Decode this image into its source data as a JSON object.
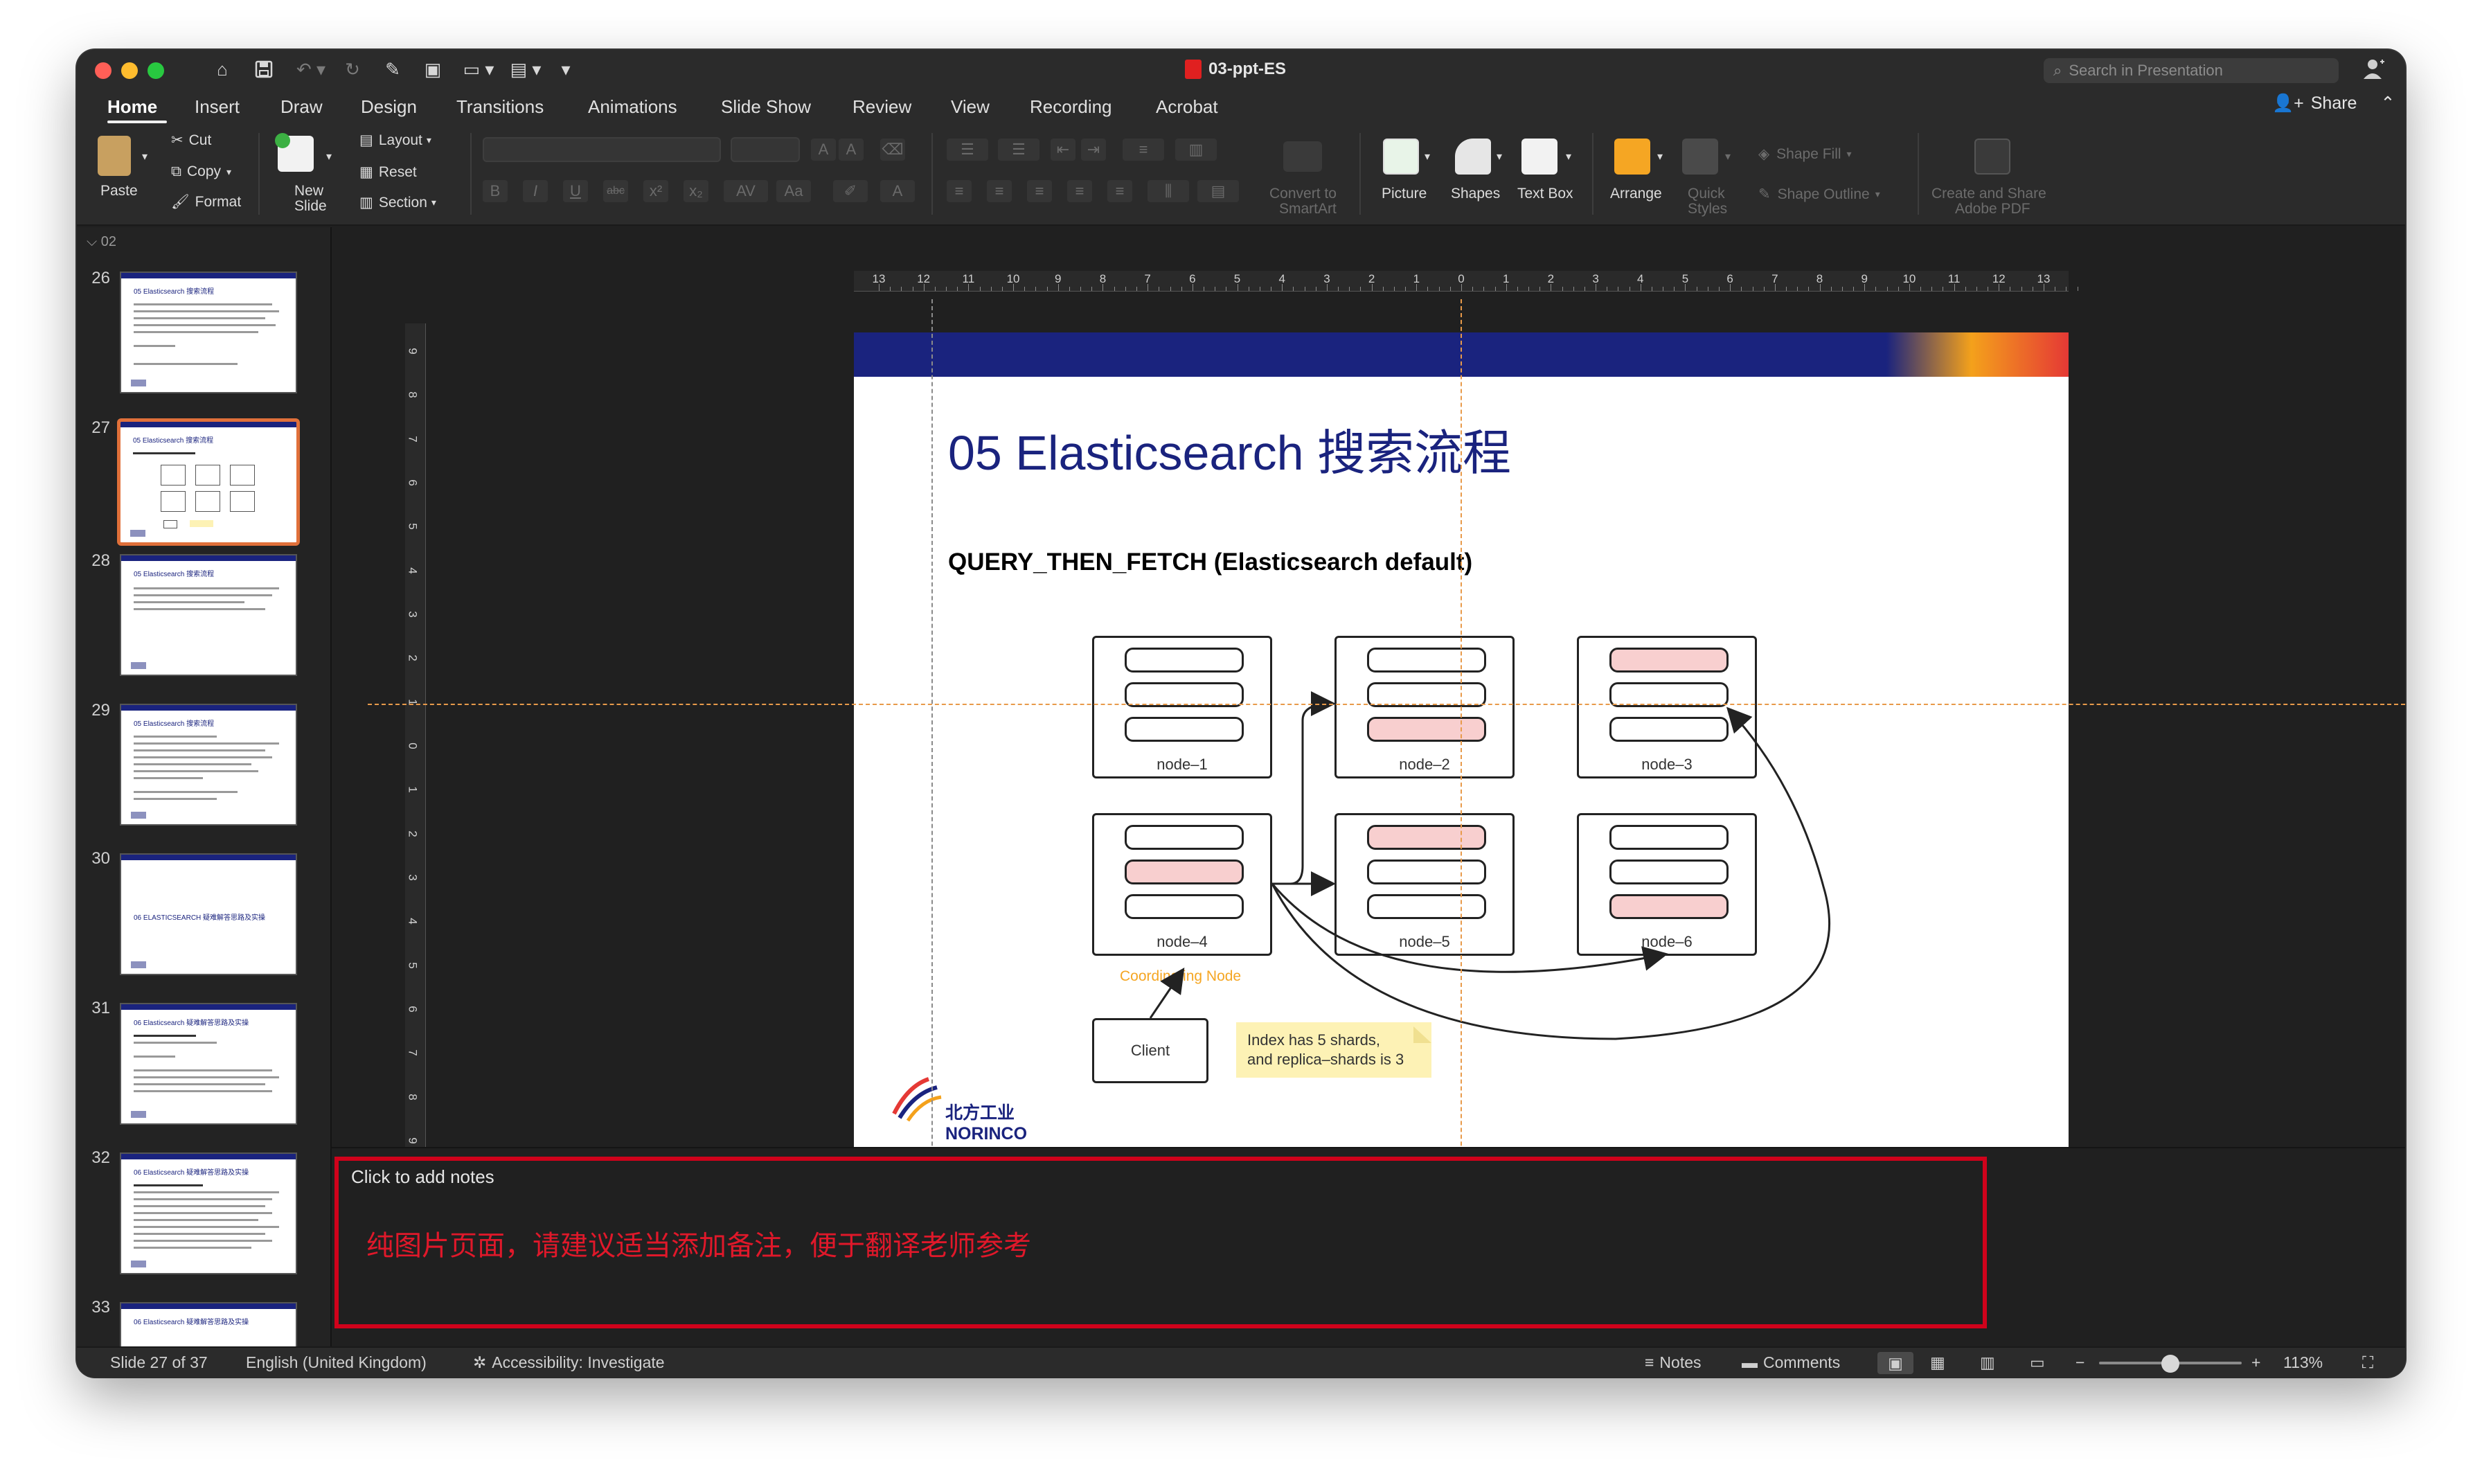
{
  "window": {
    "title": "03-ppt-ES",
    "search_placeholder": "Search in Presentation",
    "share_label": "Share"
  },
  "tabs": [
    "Home",
    "Insert",
    "Draw",
    "Design",
    "Transitions",
    "Animations",
    "Slide Show",
    "Review",
    "View",
    "Recording",
    "Acrobat"
  ],
  "ribbon": {
    "paste": "Paste",
    "cut": "Cut",
    "copy": "Copy",
    "format": "Format",
    "new_slide_1": "New",
    "new_slide_2": "Slide",
    "layout": "Layout",
    "reset": "Reset",
    "section": "Section",
    "convert_1": "Convert to",
    "convert_2": "SmartArt",
    "picture": "Picture",
    "shapes": "Shapes",
    "text_box": "Text Box",
    "arrange": "Arrange",
    "quick_1": "Quick",
    "quick_2": "Styles",
    "shape_fill": "Shape Fill",
    "shape_outline": "Shape Outline",
    "create_share_1": "Create and Share",
    "create_share_2": "Adobe PDF"
  },
  "slides_panel": {
    "section": "02",
    "thumbnails": [
      {
        "num": "26",
        "title": "05 Elasticsearch 搜索流程"
      },
      {
        "num": "27",
        "title": "05 Elasticsearch 搜索流程"
      },
      {
        "num": "28",
        "title": "05 Elasticsearch 搜索流程"
      },
      {
        "num": "29",
        "title": "05 Elasticsearch 搜索流程"
      },
      {
        "num": "30",
        "title": "06 ELASTICSEARCH 疑难解答思路及实操"
      },
      {
        "num": "31",
        "title": "06 Elasticsearch 疑难解答思路及实操"
      },
      {
        "num": "32",
        "title": "06 Elasticsearch 疑难解答思路及实操"
      },
      {
        "num": "33",
        "title": "06 Elasticsearch 疑难解答思路及实操"
      }
    ]
  },
  "ruler": {
    "h_labels": [
      "13",
      "12",
      "11",
      "10",
      "9",
      "8",
      "7",
      "6",
      "5",
      "4",
      "3",
      "2",
      "1",
      "0",
      "1",
      "2",
      "3",
      "4",
      "5",
      "6",
      "7",
      "8",
      "9",
      "10",
      "11",
      "12",
      "13"
    ],
    "v_labels": [
      "9",
      "8",
      "7",
      "6",
      "5",
      "4",
      "3",
      "2",
      "1",
      "0",
      "1",
      "2",
      "3",
      "4",
      "5",
      "6",
      "7",
      "8",
      "9"
    ]
  },
  "slide": {
    "title": "05 Elasticsearch 搜索流程",
    "subtitle": "QUERY_THEN_FETCH (Elasticsearch default)",
    "nodes": [
      "node–1",
      "node–2",
      "node–3",
      "node–4",
      "node–5",
      "node–6"
    ],
    "coordinating_label": "Coordinating Node",
    "client_label": "Client",
    "note_line1": "Index has 5 shards,",
    "note_line2": "and replica–shards is 3",
    "logo_cn": "北方工业",
    "logo_en": "NORINCO"
  },
  "notes": {
    "placeholder": "Click to add notes",
    "comment": "纯图片页面，请建议适当添加备注，便于翻译老师参考"
  },
  "status": {
    "slide_of": "Slide 27 of 37",
    "language": "English (United Kingdom)",
    "accessibility": "Accessibility: Investigate",
    "notes": "Notes",
    "comments": "Comments",
    "zoom": "113%"
  },
  "colors": {
    "accent_selection": "#e0703a",
    "slide_title": "#1a237e",
    "shard_highlight": "#f8cfcf",
    "coordinating": "#f5a623",
    "notes_border": "#d0021b",
    "notes_comment": "#e0182a"
  }
}
